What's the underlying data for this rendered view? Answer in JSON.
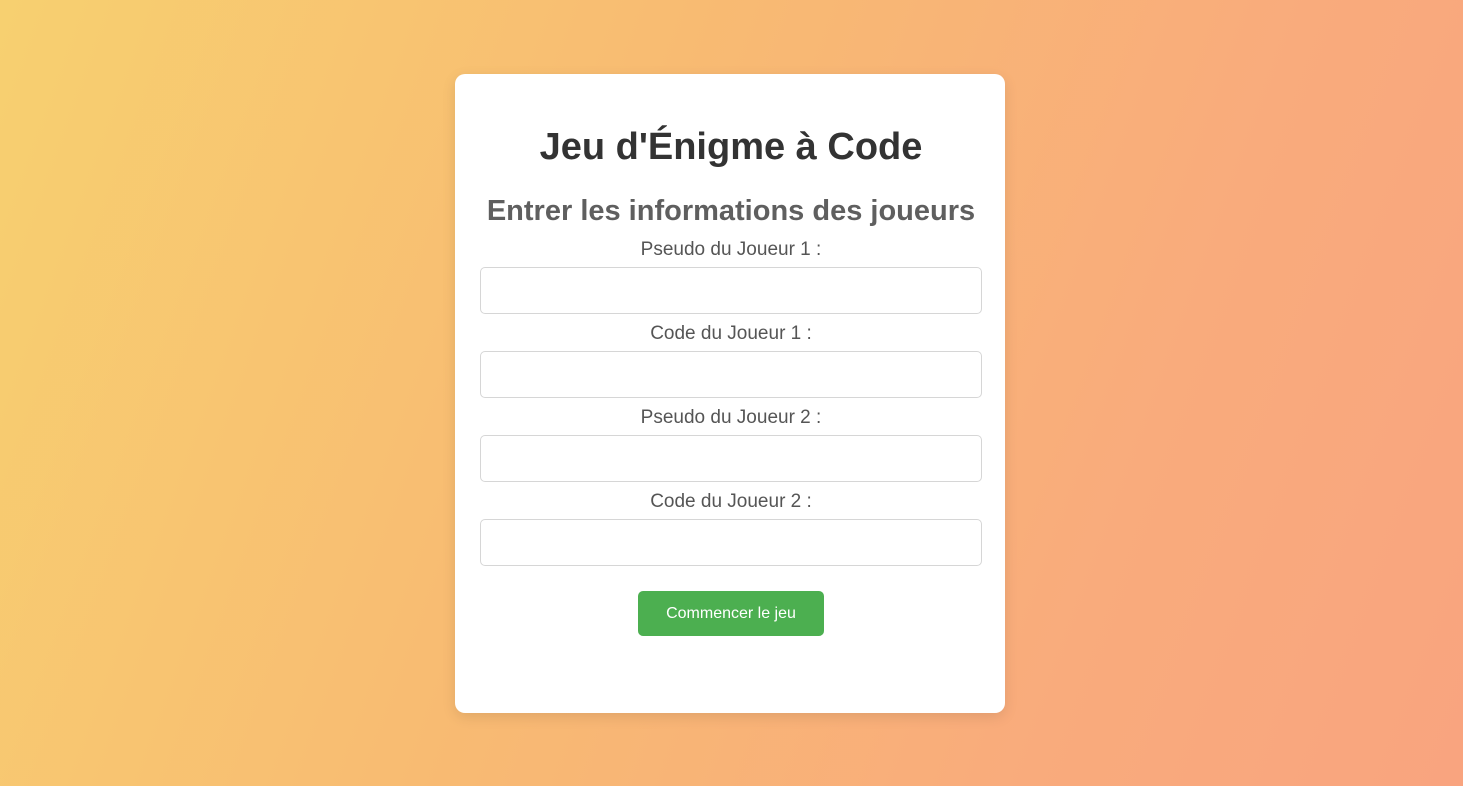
{
  "page": {
    "title": "Jeu d'Énigme à Code",
    "subtitle": "Entrer les informations des joueurs"
  },
  "form": {
    "fields": [
      {
        "label": "Pseudo du Joueur 1 :",
        "value": "",
        "placeholder": ""
      },
      {
        "label": "Code du Joueur 1 :",
        "value": "",
        "placeholder": ""
      },
      {
        "label": "Pseudo du Joueur 2 :",
        "value": "",
        "placeholder": ""
      },
      {
        "label": "Code du Joueur 2 :",
        "value": "",
        "placeholder": ""
      }
    ],
    "submit_label": "Commencer le jeu"
  },
  "colors": {
    "background_gradient_start": "#f7d070",
    "background_gradient_end": "#f9a47f",
    "card": "#ffffff",
    "title_text": "#333333",
    "subtitle_text": "#5f5f5f",
    "button": "#4caf50",
    "button_text": "#ffffff"
  }
}
